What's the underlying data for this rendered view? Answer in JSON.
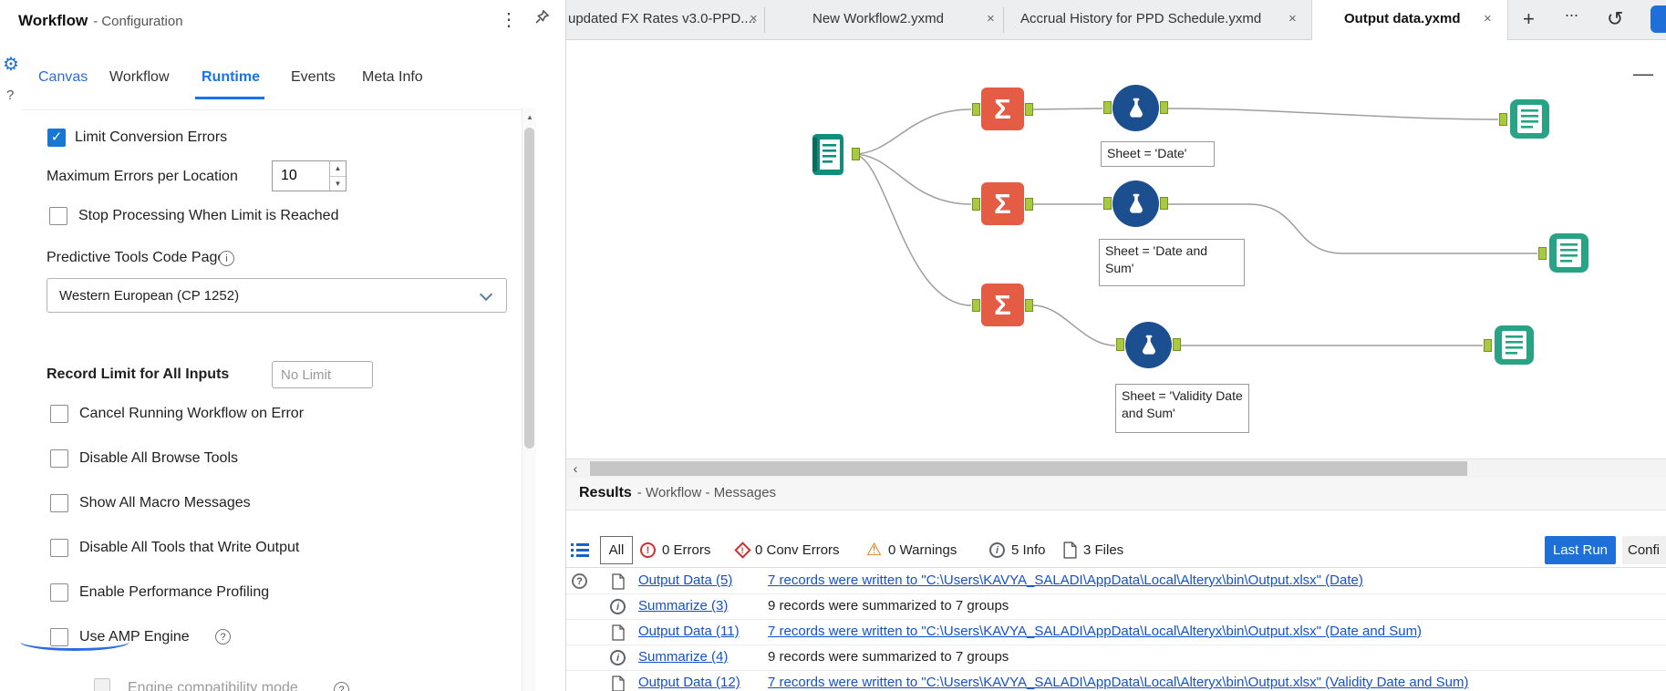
{
  "icons": {
    "gear": "⚙",
    "help": "?",
    "kebab": "⋮",
    "close": "×",
    "plus": "+",
    "more": "...",
    "history": "↺",
    "minus": "—",
    "sigma": "Σ",
    "check": "✓",
    "up": "▲",
    "down": "▼",
    "left": "‹",
    "warning": "⚠",
    "info": "i",
    "error": "!",
    "question": "?"
  },
  "config": {
    "title": "Workflow",
    "subtitle": "- Configuration",
    "tabs": [
      "Canvas",
      "Workflow",
      "Runtime",
      "Events",
      "Meta Info"
    ],
    "active_tab": "Runtime",
    "limit_conversion": "Limit Conversion Errors",
    "max_errors_label": "Maximum Errors per Location",
    "max_errors_value": "10",
    "stop_processing": "Stop Processing When Limit is Reached",
    "code_page_label": "Predictive Tools Code Page",
    "code_page_value": "Western European (CP 1252)",
    "record_limit_label": "Record Limit for All Inputs",
    "record_limit_placeholder": "No Limit",
    "options": [
      "Cancel Running Workflow on Error",
      "Disable All Browse Tools",
      "Show All Macro Messages",
      "Disable All Tools that Write Output",
      "Enable Performance Profiling",
      "Use AMP Engine"
    ],
    "engine_compat": "Engine compatibility mode"
  },
  "doc_tabs": {
    "tabs": [
      {
        "label": "updated FX Rates v3.0-PPD...."
      },
      {
        "label": "New Workflow2.yxmd"
      },
      {
        "label": "Accrual History for PPD Schedule.yxmd"
      },
      {
        "label": "Output data.yxmd"
      }
    ],
    "active": "Output data.yxmd"
  },
  "canvas": {
    "annotations": [
      "Sheet = 'Date'",
      "Sheet = 'Date and Sum'",
      "Sheet = 'Validity Date and Sum'"
    ]
  },
  "results": {
    "title": "Results",
    "subtitle": "- Workflow - Messages",
    "filters": {
      "all": "All",
      "errors": "0 Errors",
      "conv_errors": "0 Conv Errors",
      "warnings": "0 Warnings",
      "info": "5 Info",
      "files": "3 Files",
      "last_run": "Last Run",
      "config": "Confi"
    },
    "rows": [
      {
        "tool": "Output Data (5)",
        "message": "7 records were written to \"C:\\Users\\KAVYA_SALADI\\AppData\\Local\\Alteryx\\bin\\Output.xlsx\" (Date)"
      },
      {
        "tool": "Summarize (3)",
        "message": "9 records were summarized to 7 groups"
      },
      {
        "tool": "Output Data (11)",
        "message": "7 records were written to \"C:\\Users\\KAVYA_SALADI\\AppData\\Local\\Alteryx\\bin\\Output.xlsx\" (Date and Sum)"
      },
      {
        "tool": "Summarize (4)",
        "message": "9 records were summarized to 7 groups"
      },
      {
        "tool": "Output Data (12)",
        "message": "7 records were written to \"C:\\Users\\KAVYA_SALADI\\AppData\\Local\\Alteryx\\bin\\Output.xlsx\" (Validity Date and Sum)"
      }
    ]
  }
}
